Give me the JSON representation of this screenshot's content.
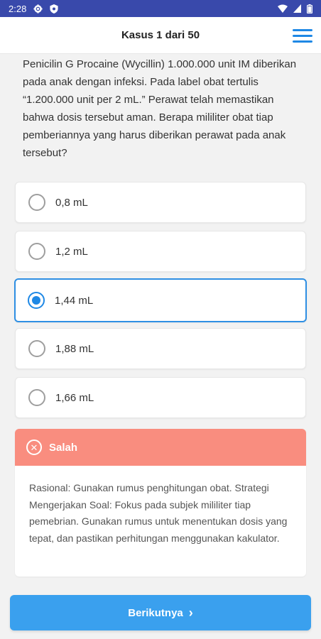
{
  "status_bar": {
    "time": "2:28"
  },
  "header": {
    "title": "Kasus 1 dari 50"
  },
  "question": {
    "text": "Penicilin G Procaine (Wycillin) 1.000.000 unit IM diberikan pada anak dengan infeksi. Pada label obat tertulis “1.200.000 unit per 2 mL.” Perawat telah memastikan bahwa dosis tersebut aman. Berapa mililiter obat tiap pemberiannya yang harus diberikan perawat pada anak tersebut?"
  },
  "options": [
    {
      "label": "0,8 mL",
      "selected": false
    },
    {
      "label": "1,2 mL",
      "selected": false
    },
    {
      "label": "1,44 mL",
      "selected": true
    },
    {
      "label": "1,88 mL",
      "selected": false
    },
    {
      "label": "1,66 mL",
      "selected": false
    }
  ],
  "feedback": {
    "status": "Salah",
    "text": "Rasional: Gunakan rumus penghitungan obat. Strategi Mengerjakan Soal: Fokus pada subjek mililiter tiap pemebrian. Gunakan rumus untuk menentukan dosis yang tepat, dan pastikan perhitungan menggunakan kakulator."
  },
  "footer": {
    "next_label": "Berikutnya"
  },
  "colors": {
    "status_bar": "#3949ab",
    "accent": "#1e88e5",
    "wrong": "#f98d7f",
    "next_button": "#3aa0ee"
  },
  "icons": {
    "status_left": [
      "gear-icon",
      "shield-icon"
    ],
    "status_right": [
      "wifi-icon",
      "signal-icon",
      "battery-icon"
    ],
    "menu": "hamburger-menu-icon",
    "feedback": "x-circle-icon",
    "next": "chevron-right-icon"
  }
}
